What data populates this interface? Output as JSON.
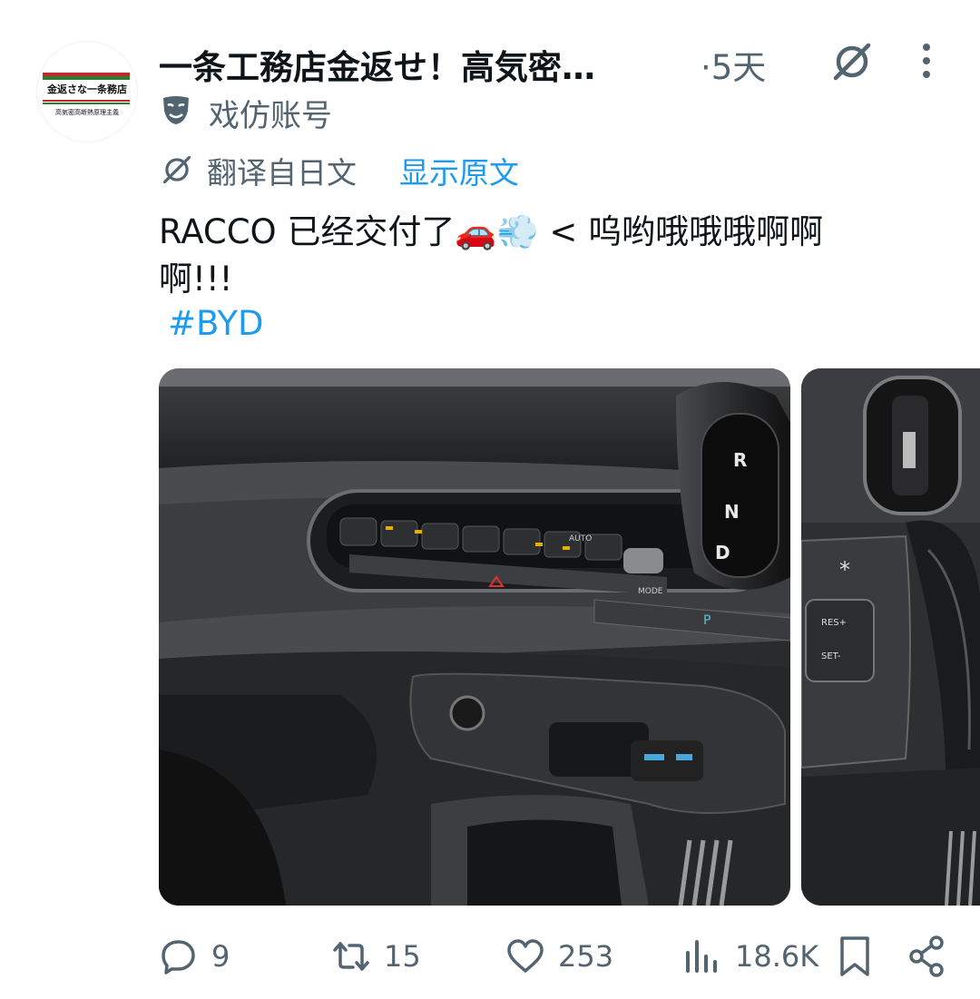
{
  "tweet": {
    "author_name": "一条工務店金返せ！高気密…",
    "time": "·5天",
    "parody_label": "戏仿账号",
    "translate_label": "翻译自日文",
    "show_original": "显示原文",
    "text_line1": "RACCO 已经交付了🚗💨 < 呜哟哦哦哦啊啊",
    "text_line2": "啊!!!",
    "hashtag": "#BYD"
  },
  "avatar": {
    "line1": "金返さな一条務店",
    "line2": "高気密高断熱原理主義",
    "stripe_colors": [
      "#c0282d",
      "#ffffff",
      "#2e7d32"
    ]
  },
  "images": [
    {
      "shift_labels": [
        "R",
        "N",
        "D"
      ],
      "panel_label": "AUTO",
      "mode_label": "MODE",
      "gear_label": "P"
    },
    {
      "labels": [
        "RES+",
        "SET-"
      ]
    }
  ],
  "actions": {
    "replies": "9",
    "retweets": "15",
    "likes": "253",
    "views": "18.6K"
  },
  "icons": [
    "grok-icon",
    "more-icon",
    "parody-icon",
    "translate-icon",
    "reply-icon",
    "retweet-icon",
    "like-icon",
    "views-icon",
    "bookmark-icon",
    "share-icon"
  ]
}
